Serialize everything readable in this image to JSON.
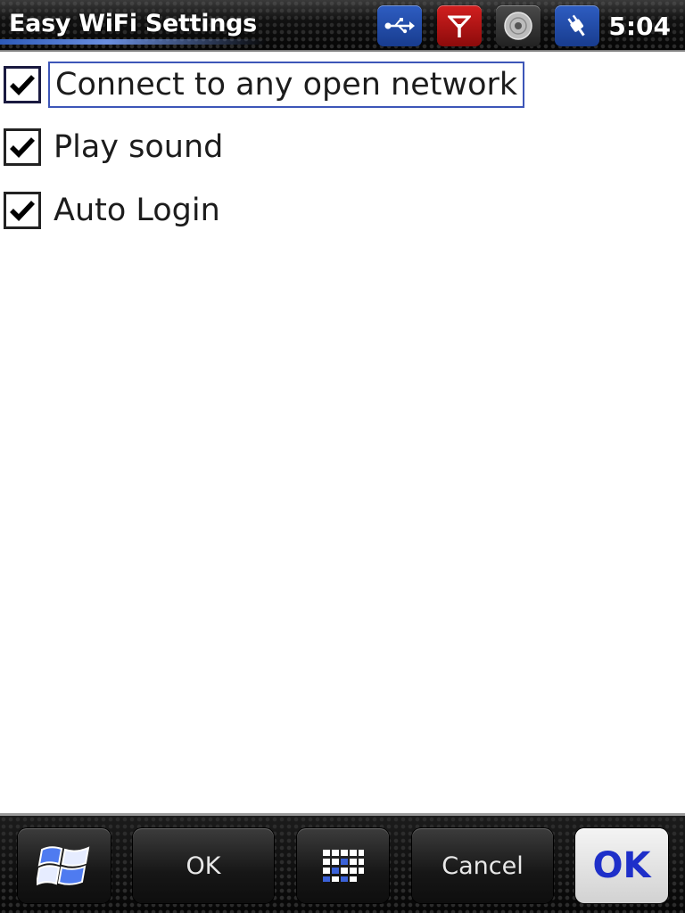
{
  "titlebar": {
    "title": "Easy WiFi Settings",
    "clock": "5:04",
    "status_icons": [
      "usb-icon",
      "signal-icon",
      "disc-icon",
      "power-icon"
    ]
  },
  "options": [
    {
      "label": "Connect to any open network",
      "checked": true,
      "focused": true
    },
    {
      "label": "Play sound",
      "checked": true,
      "focused": false
    },
    {
      "label": "Auto Login",
      "checked": true,
      "focused": false
    }
  ],
  "softbar": {
    "start_icon": "windows-flag-icon",
    "ok_label": "OK",
    "keyboard_icon": "keyboard-icon",
    "cancel_label": "Cancel",
    "ok_big_label": "OK"
  },
  "colors": {
    "accent_blue": "#2e5dc2",
    "alert_red": "#d21f1f",
    "focus_border": "#3d56b8",
    "ok_text": "#1e2fc9"
  }
}
